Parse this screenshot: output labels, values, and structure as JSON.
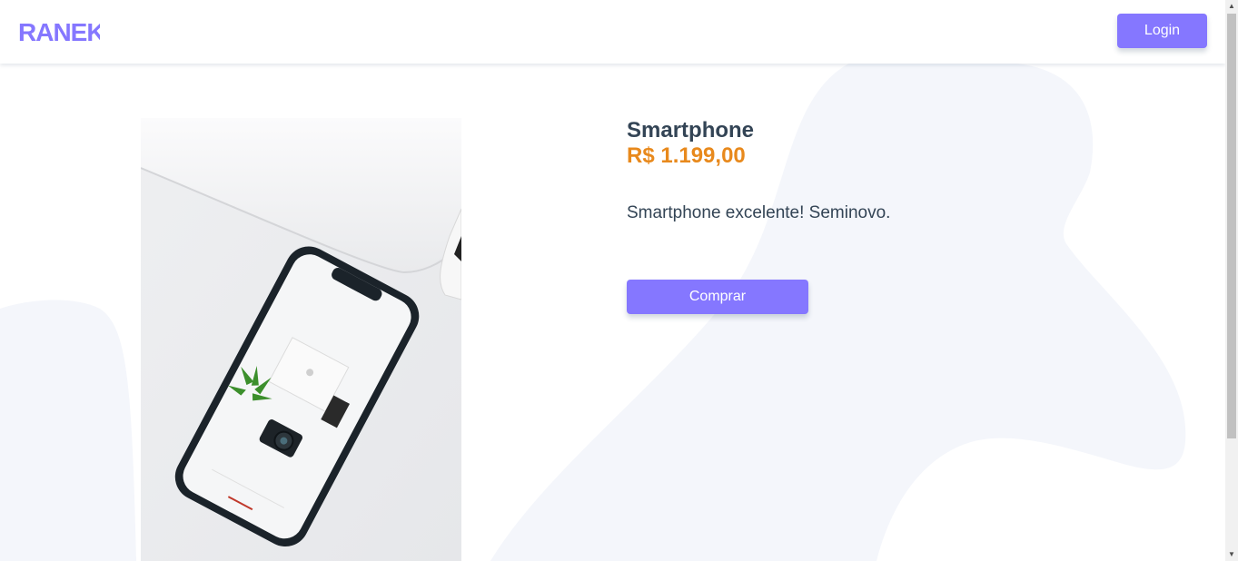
{
  "header": {
    "logo_text": "RANEK",
    "login_label": "Login"
  },
  "product": {
    "title": "Smartphone",
    "price": "R$ 1.199,00",
    "description": "Smartphone excelente! Seminovo.",
    "buy_label": "Comprar",
    "image_icon": "product-photo"
  },
  "colors": {
    "accent": "#8577ff",
    "price": "#e8891c",
    "text": "#334455",
    "background_blob": "#f4f6fb"
  }
}
